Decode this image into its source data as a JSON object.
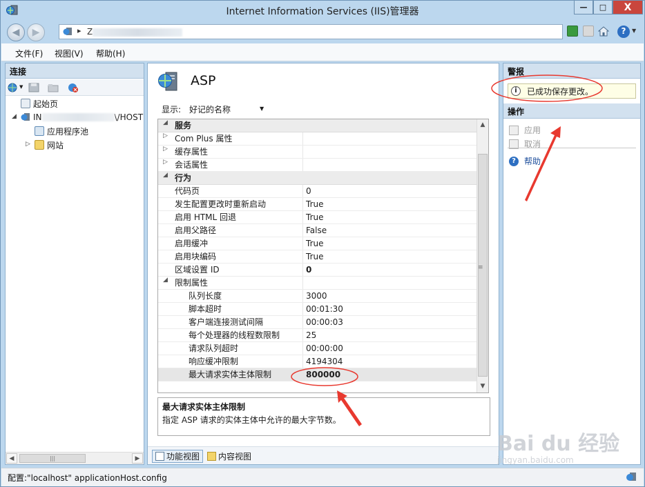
{
  "window": {
    "title": "Internet Information Services (IIS)管理器",
    "min_label": "—",
    "max_label": "□",
    "close_label": "X"
  },
  "address": {
    "separator": "▸",
    "prefix": "Z"
  },
  "menu": [
    "文件(F)",
    "视图(V)",
    "帮助(H)"
  ],
  "connections": {
    "header": "连接",
    "nodes": {
      "start": "起始页",
      "server_prefix": "IN",
      "server_suffix": "\\/HOST",
      "apppools": "应用程序池",
      "sites": "网站"
    }
  },
  "center": {
    "title": "ASP",
    "show_label": "显示:",
    "show_value": "好记的名称",
    "properties": [
      {
        "type": "group",
        "expand": "◢",
        "name": "服务"
      },
      {
        "type": "item",
        "expand": "▷",
        "name": "Com Plus 属性",
        "value": ""
      },
      {
        "type": "item",
        "expand": "▷",
        "name": "缓存属性",
        "value": ""
      },
      {
        "type": "item",
        "expand": "▷",
        "name": "会话属性",
        "value": ""
      },
      {
        "type": "group",
        "expand": "◢",
        "name": "行为"
      },
      {
        "type": "item",
        "expand": "",
        "name": "代码页",
        "value": "0"
      },
      {
        "type": "item",
        "expand": "",
        "name": "发生配置更改时重新启动",
        "value": "True"
      },
      {
        "type": "item",
        "expand": "",
        "name": "启用 HTML 回退",
        "value": "True"
      },
      {
        "type": "item",
        "expand": "",
        "name": "启用父路径",
        "value": "False"
      },
      {
        "type": "item",
        "expand": "",
        "name": "启用缓冲",
        "value": "True"
      },
      {
        "type": "item",
        "expand": "",
        "name": "启用块编码",
        "value": "True"
      },
      {
        "type": "item",
        "expand": "",
        "name": "区域设置 ID",
        "value": "0",
        "bold": true
      },
      {
        "type": "item",
        "expand": "◢",
        "name": "限制属性",
        "value": ""
      },
      {
        "type": "sub",
        "expand": "",
        "name": "队列长度",
        "value": "3000"
      },
      {
        "type": "sub",
        "expand": "",
        "name": "脚本超时",
        "value": "00:01:30"
      },
      {
        "type": "sub",
        "expand": "",
        "name": "客户端连接测试间隔",
        "value": "00:00:03"
      },
      {
        "type": "sub",
        "expand": "",
        "name": "每个处理器的线程数限制",
        "value": "25"
      },
      {
        "type": "sub",
        "expand": "",
        "name": "请求队列超时",
        "value": "00:00:00"
      },
      {
        "type": "sub",
        "expand": "",
        "name": "响应缓冲限制",
        "value": "4194304"
      },
      {
        "type": "sub",
        "expand": "",
        "name": "最大请求实体主体限制",
        "value": "800000",
        "bold": true,
        "selected": true
      }
    ],
    "description": {
      "title": "最大请求实体主体限制",
      "text": "指定 ASP 请求的实体主体中允许的最大字节数。"
    },
    "views": {
      "features": "功能视图",
      "content": "内容视图"
    }
  },
  "right": {
    "alerts_header": "警报",
    "alert_message": "已成功保存更改。",
    "actions_header": "操作",
    "apply": "应用",
    "cancel": "取消",
    "help": "帮助"
  },
  "status": {
    "text": "配置:\"localhost\" applicationHost.config"
  },
  "watermark": {
    "text": "Bai du 经验",
    "sub": "jingyan.baidu.com"
  },
  "colors": {
    "annotation": "#e8392f",
    "accent": "#2d6fc2"
  }
}
